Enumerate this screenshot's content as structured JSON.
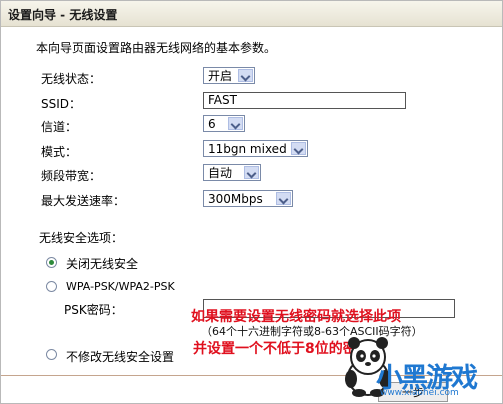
{
  "title": "设置向导 - 无线设置",
  "description": "本向导页面设置路由器无线网络的基本参数。",
  "fields": {
    "wireless_status": {
      "label": "无线状态：",
      "value": "开启"
    },
    "ssid": {
      "label": "SSID：",
      "value": "FAST"
    },
    "channel": {
      "label": "信道：",
      "value": "6"
    },
    "mode": {
      "label": "模式：",
      "value": "11bgn mixed"
    },
    "bandwidth": {
      "label": "频段带宽：",
      "value": "自动"
    },
    "max_rate": {
      "label": "最大发送速率：",
      "value": "300Mbps"
    }
  },
  "security": {
    "heading": "无线安全选项：",
    "option_off": "关闭无线安全",
    "option_wpa": "WPA-PSK/WPA2-PSK",
    "psk_label": "PSK密码：",
    "psk_value": "",
    "option_keep": "不修改无线安全设置",
    "selected": "off"
  },
  "annotation": {
    "line1": "如果需要设置无线密码就选择此项",
    "line2": "（64个十六进制字符或8-63个ASCII码字符）",
    "line3": "并设置一个不低于8位的密码"
  },
  "bottom_button_fragment": "一步",
  "watermark": {
    "brand": "小黑游戏",
    "url": "www.xiaohei.com"
  },
  "colors": {
    "annotation": "#e0101e",
    "watermark_blue": "#1f78d1",
    "watermark_green": "#59b52a"
  }
}
